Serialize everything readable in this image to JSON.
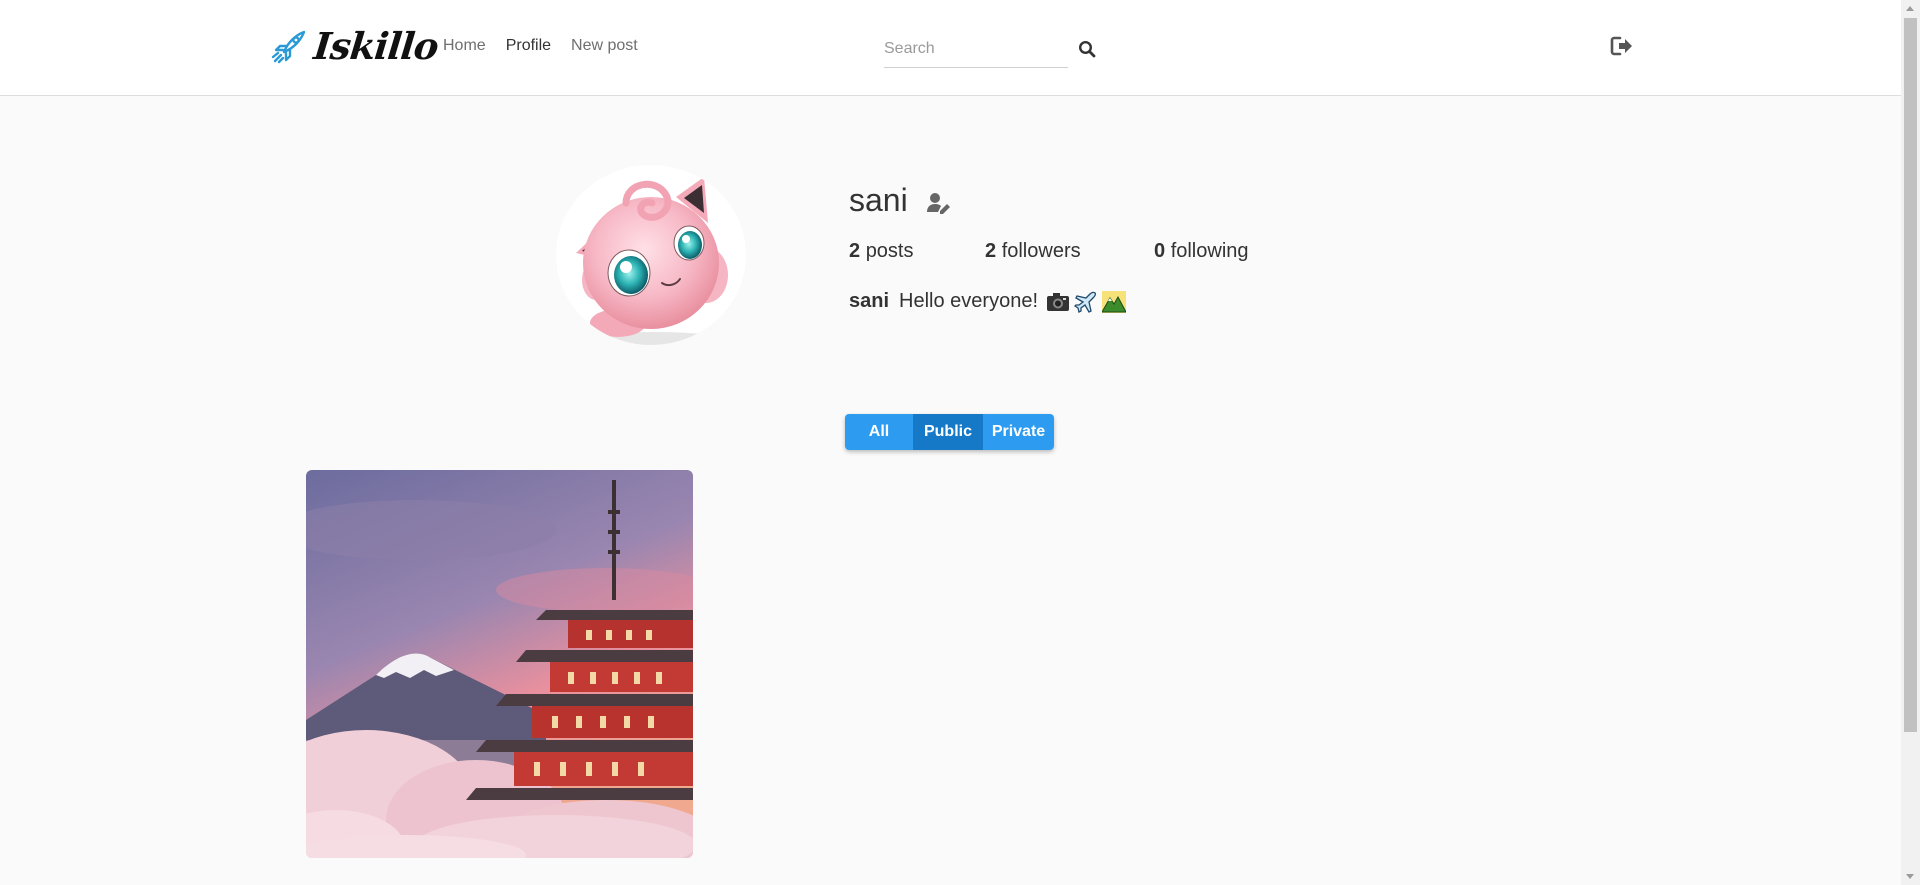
{
  "header": {
    "brand": "Iskillo",
    "nav": [
      {
        "label": "Home",
        "active": false
      },
      {
        "label": "Profile",
        "active": true
      },
      {
        "label": "New post",
        "active": false
      }
    ],
    "search_placeholder": "Search",
    "search_value": ""
  },
  "profile": {
    "username": "sani",
    "stats": [
      {
        "count": "2",
        "label": "posts"
      },
      {
        "count": "2",
        "label": "followers"
      },
      {
        "count": "0",
        "label": "following"
      }
    ],
    "bio_user": "sani",
    "bio_text": "Hello everyone!",
    "bio_emojis": [
      "camera-emoji",
      "airplane-emoji",
      "mountain-emoji"
    ]
  },
  "filters": [
    {
      "label": "All",
      "active": false
    },
    {
      "label": "Public",
      "active": true
    },
    {
      "label": "Private",
      "active": false
    }
  ],
  "colors": {
    "accent": "#2d9cf0",
    "accent_active": "#1679c8",
    "page_bg": "#fafafa",
    "header_bg": "#ffffff",
    "text": "#333333"
  },
  "icons": {
    "logo": "rocket-icon",
    "search": "search-icon",
    "logout": "logout-icon",
    "edit_profile": "edit-profile-icon"
  }
}
